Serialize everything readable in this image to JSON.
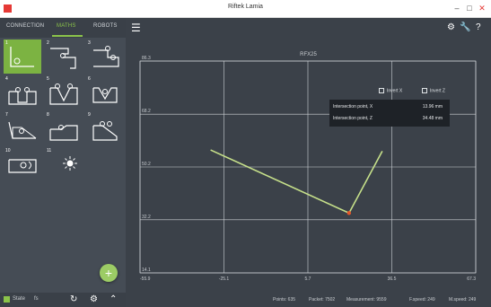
{
  "window": {
    "title": "Riftek Lamia",
    "accent": "#8bc34a",
    "background": "#3b4149"
  },
  "left_panel": {
    "tabs": [
      {
        "label": "CONNECTION"
      },
      {
        "label": "MATHS"
      },
      {
        "label": "ROBOTS"
      }
    ],
    "active_tab_index": 1,
    "cells": [
      {
        "num": "1"
      },
      {
        "num": "2"
      },
      {
        "num": "3"
      },
      {
        "num": "4"
      },
      {
        "num": "5"
      },
      {
        "num": "6"
      },
      {
        "num": "7"
      },
      {
        "num": "8"
      },
      {
        "num": "9"
      },
      {
        "num": "10"
      },
      {
        "num": "11"
      }
    ],
    "selected_cell_index": 0,
    "footer": {
      "state_label": "State",
      "fs_label": "fs"
    }
  },
  "toolbar": {
    "icons": [
      "menu-icon",
      "gear-icon",
      "wrench-icon",
      "help-icon"
    ]
  },
  "plot": {
    "title": "RFX25",
    "legend": {
      "invert_x": "Invert X",
      "invert_z": "Invert Z"
    },
    "tooltip": {
      "row1_label": "Intersection point, X",
      "row1_value": "13.96 mm",
      "row2_label": "Intersection point, Z",
      "row2_value": "34.48 mm"
    }
  },
  "chart_data": {
    "type": "line",
    "title": "RFX25",
    "xlim": [
      -55.9,
      67.3
    ],
    "ylim": [
      14.1,
      86.3
    ],
    "x_ticks": [
      "-55.9",
      "-25.1",
      "5.7",
      "36.5",
      "67.3"
    ],
    "y_ticks": [
      "86.3",
      "68.2",
      "50.2",
      "32.2",
      "14.1"
    ],
    "grid": true,
    "series": [
      {
        "color": "#c6e08a",
        "points": [
          [
            -30.0,
            56.0
          ],
          [
            20.8,
            34.5
          ],
          [
            33.0,
            55.6
          ]
        ]
      }
    ],
    "marker": {
      "x": 20.8,
      "y": 34.5,
      "color": "#e5572a"
    }
  },
  "status": {
    "points": "Points: 635",
    "packet": "Packet: 7502",
    "measurement": "Measurement: 9559",
    "fspeed": "F.speed: 249",
    "mspeed": "M.speed: 249"
  }
}
